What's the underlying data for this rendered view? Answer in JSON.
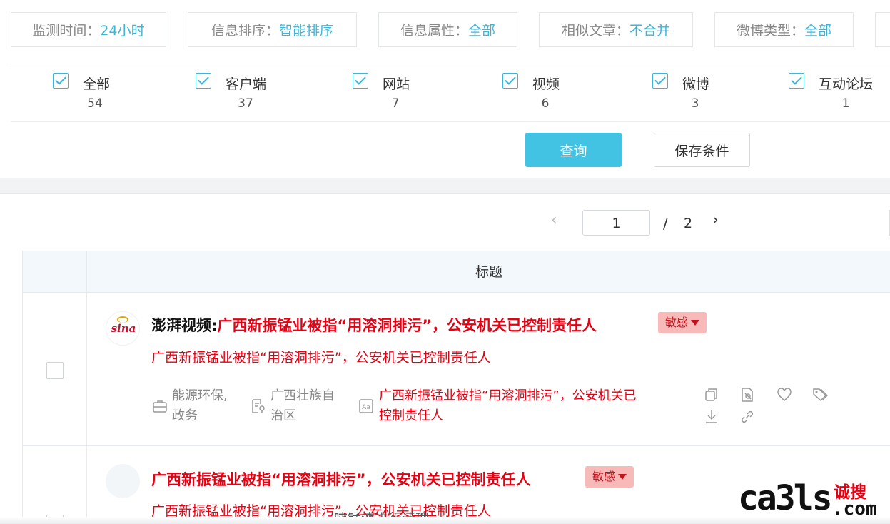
{
  "filters": [
    {
      "label": "监测时间：",
      "value": "24小时"
    },
    {
      "label": "信息排序：",
      "value": "智能排序"
    },
    {
      "label": "信息属性：",
      "value": "全部"
    },
    {
      "label": "相似文章：",
      "value": "不合并"
    },
    {
      "label": "微博类型：",
      "value": "全部"
    }
  ],
  "types": [
    {
      "label": "全部",
      "count": "54"
    },
    {
      "label": "客户端",
      "count": "37"
    },
    {
      "label": "网站",
      "count": "7"
    },
    {
      "label": "视频",
      "count": "6"
    },
    {
      "label": "微博",
      "count": "3"
    },
    {
      "label": "互动论坛",
      "count": "1"
    }
  ],
  "actions": {
    "query_label": "查询",
    "save_label": "保存条件"
  },
  "pagination": {
    "current": "1",
    "separator": "/",
    "total": "2",
    "prev_icon": "chevron-left-icon",
    "next_icon": "chevron-right-icon"
  },
  "table": {
    "title_header": "标题"
  },
  "rows": [
    {
      "source": "澎湃视频:",
      "title": "广西新振锰业被指“用溶洞排污”，公安机关已控制责任人",
      "badge": "敏感",
      "summary": "广西新振锰业被指“用溶洞排污”，公安机关已控制责任人",
      "category_line1": "能源环保,",
      "category_line2": "政务",
      "region_line1": "广西壮族自",
      "region_line2": "治区",
      "keyword_line1": "广西新振锰业被指“用溶洞排污”，公安机关已",
      "keyword_line2": "控制责任人",
      "avatar_text": "sina"
    },
    {
      "title": "广西新振锰业被指“用溶洞排污”，公安机关已控制责任人",
      "badge": "敏感",
      "summary": "广西新振锰业被指“用溶洞排污”，公安机关已控制责任人"
    }
  ],
  "cutoff_text": "吨锰渣进行清理。",
  "watermark": {
    "main": "ca3ls",
    "cn": "诚搜",
    "com": ".com"
  },
  "colors": {
    "accent": "#3bb5d9",
    "query_button": "#42c3e4",
    "headline_red": "#e60012",
    "badge_bg": "#f8b9b9"
  }
}
